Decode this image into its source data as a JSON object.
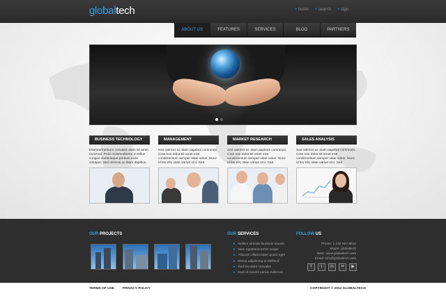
{
  "header": {
    "logo_part1": "global",
    "logo_part2": "tech",
    "top_links": [
      "home",
      "search",
      "sign"
    ]
  },
  "nav": {
    "items": [
      "ABOUT US",
      "FEATURES",
      "SERVICES",
      "BLOG",
      "PARTNERS"
    ]
  },
  "columns": [
    {
      "title": "BUSINESS TECHNOLOGY",
      "text": "Etiamfermentum convallis diam sit amet euismod. Proin euismodtortor in tellus congue scelerisque pretium enim volutpat. Sed ulereos ac diam dapibus."
    },
    {
      "title": "MANAGEMENT",
      "text": "Sed ulereos ac diam dapibus commodo. Cras non dolor sit amet erat condimentum semper vitae velus. Nunc id leo elit, vitae varius orci. Sed"
    },
    {
      "title": "MARKET RESEARCH",
      "text": "Sed ulereos ac diam dapibus commodo. Cras non dolor sit amet erat condimentum semper vitae velus. Nunc id leo elit, vitae varius orci. Sed"
    },
    {
      "title": "SALES ANALYSIS",
      "text": "Sed ulereos ac diam dapibus commodo. Cras non dolor sit amet erat condimentum semper vitae velus. Nunc id leo elit, vitae varius orci. Sed"
    }
  ],
  "footer": {
    "projects_hl": "OUR",
    "projects_rest": "PROJECTS",
    "services_hl": "OUR",
    "services_rest": "SERVICES",
    "follow_hl": "FOLLOW",
    "follow_rest": "US",
    "services": [
      "Nullam vlrtcula faucibus mauris",
      "Nam egestena tortor neque",
      "Aliquam ullamcorper quam eget",
      "Metus adipiscing et eleifend",
      "Sed tincidunt convallis",
      "Duis id mauris varius euismod"
    ],
    "contact": [
      "Phone: 1 234 567 8910",
      "Skype: globaltech",
      "Web: www.globaltech.web",
      "Email: info@globaltech.web"
    ],
    "social_icons": [
      "facebook-icon",
      "twitter-icon",
      "linkedin-icon",
      "flickr-icon",
      "youtube-icon"
    ]
  },
  "bottom": {
    "terms": "TERMS OF USE",
    "privacy": "PRIVACY POLICY",
    "copyright": "COPYRIGHT © 2012 GLOBALTECH"
  },
  "colors": {
    "accent": "#3aa0dd",
    "dark": "#2e2e2e"
  }
}
